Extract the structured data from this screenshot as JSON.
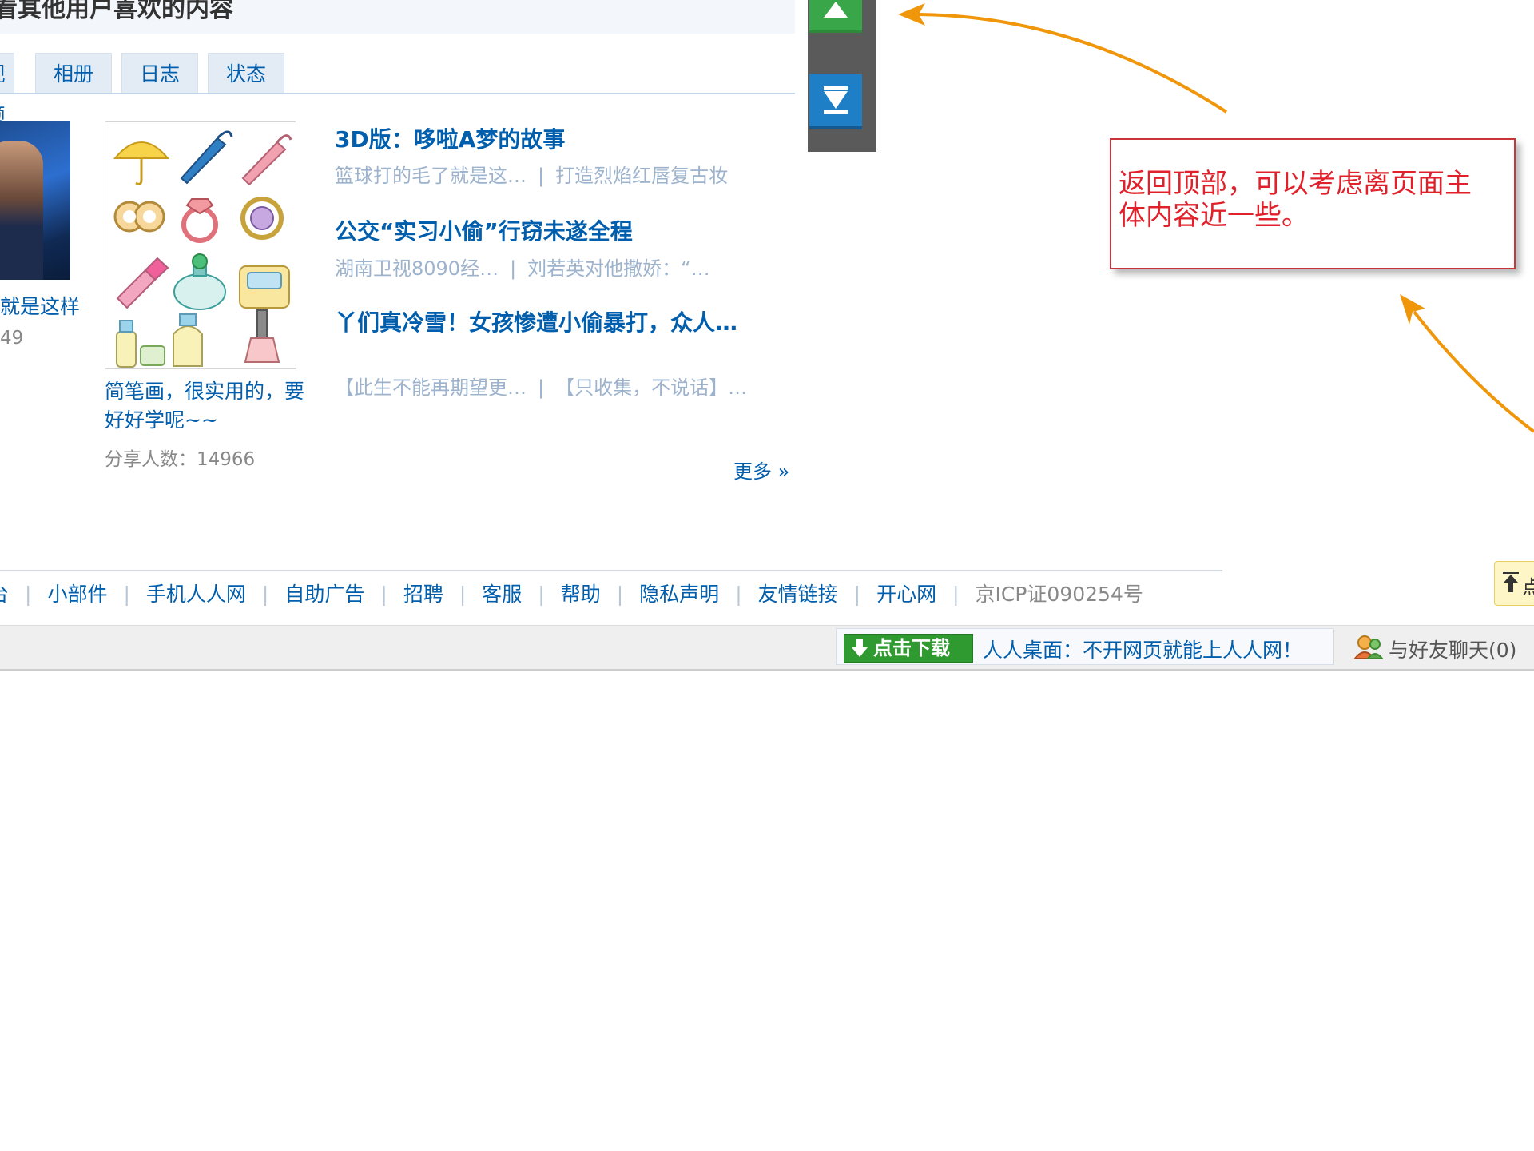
{
  "header": {
    "title": "看其他用户喜欢的内容"
  },
  "tabs": [
    {
      "label": "视频"
    },
    {
      "label": "相册"
    },
    {
      "label": "日志"
    },
    {
      "label": "状态"
    }
  ],
  "cards": {
    "left": {
      "title": "就是这样",
      "count": "49"
    },
    "middle": {
      "title": "简笔画，很实用的，要好好学呢~~",
      "count": "分享人数：14966"
    }
  },
  "news": [
    {
      "headline": "3D版：哆啦A梦的故事",
      "links": [
        "篮球打的毛了就是这…",
        "打造烈焰红唇复古妆"
      ]
    },
    {
      "headline": "公交“实习小偷”行窃未遂全程",
      "links": [
        "湖南卫视8090经…",
        "刘若英对他撒娇：“…"
      ]
    },
    {
      "headline": "丫们真冷雪！女孩惨遭小偷暴打，众人…",
      "links": [
        "【此生不能再期望更…",
        "【只收集，不说话】…"
      ]
    }
  ],
  "more_label": "更多 »",
  "back_to_top": {
    "up_icon": "arrow-up-icon",
    "down_icon": "arrow-down-icon"
  },
  "annotation": {
    "text": "返回顶部，可以考虑离页面主体内容近一些。"
  },
  "footer": {
    "links": [
      "台",
      "小部件",
      "手机人人网",
      "自助广告",
      "招聘",
      "客服",
      "帮助",
      "隐私声明",
      "友情链接",
      "开心网"
    ],
    "icp": "京ICP证090254号"
  },
  "side_tag": {
    "label": "点"
  },
  "bottom_bar": {
    "download_label": "点击下载",
    "desktop_text": "人人桌面：不开网页就能上人人网！",
    "chat_label": "与好友聊天(0)"
  },
  "colors": {
    "link": "#005eac",
    "accent_green": "#3aa64a",
    "accent_blue": "#1e7fc6",
    "annotation_red": "#e0202a",
    "arrow_orange": "#f0960a"
  }
}
